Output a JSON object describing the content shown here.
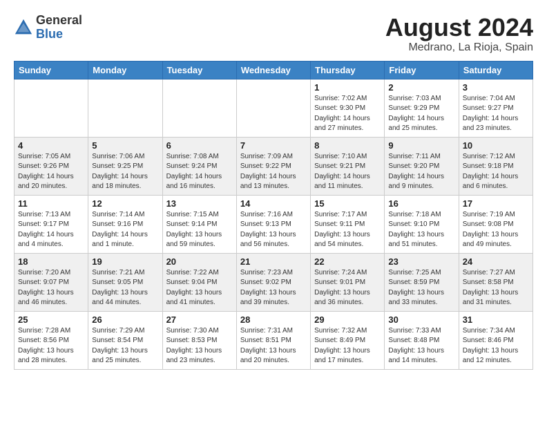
{
  "header": {
    "logo_line1": "General",
    "logo_line2": "Blue",
    "month_year": "August 2024",
    "location": "Medrano, La Rioja, Spain"
  },
  "weekdays": [
    "Sunday",
    "Monday",
    "Tuesday",
    "Wednesday",
    "Thursday",
    "Friday",
    "Saturday"
  ],
  "weeks": [
    [
      {
        "day": "",
        "info": ""
      },
      {
        "day": "",
        "info": ""
      },
      {
        "day": "",
        "info": ""
      },
      {
        "day": "",
        "info": ""
      },
      {
        "day": "1",
        "info": "Sunrise: 7:02 AM\nSunset: 9:30 PM\nDaylight: 14 hours\nand 27 minutes."
      },
      {
        "day": "2",
        "info": "Sunrise: 7:03 AM\nSunset: 9:29 PM\nDaylight: 14 hours\nand 25 minutes."
      },
      {
        "day": "3",
        "info": "Sunrise: 7:04 AM\nSunset: 9:27 PM\nDaylight: 14 hours\nand 23 minutes."
      }
    ],
    [
      {
        "day": "4",
        "info": "Sunrise: 7:05 AM\nSunset: 9:26 PM\nDaylight: 14 hours\nand 20 minutes."
      },
      {
        "day": "5",
        "info": "Sunrise: 7:06 AM\nSunset: 9:25 PM\nDaylight: 14 hours\nand 18 minutes."
      },
      {
        "day": "6",
        "info": "Sunrise: 7:08 AM\nSunset: 9:24 PM\nDaylight: 14 hours\nand 16 minutes."
      },
      {
        "day": "7",
        "info": "Sunrise: 7:09 AM\nSunset: 9:22 PM\nDaylight: 14 hours\nand 13 minutes."
      },
      {
        "day": "8",
        "info": "Sunrise: 7:10 AM\nSunset: 9:21 PM\nDaylight: 14 hours\nand 11 minutes."
      },
      {
        "day": "9",
        "info": "Sunrise: 7:11 AM\nSunset: 9:20 PM\nDaylight: 14 hours\nand 9 minutes."
      },
      {
        "day": "10",
        "info": "Sunrise: 7:12 AM\nSunset: 9:18 PM\nDaylight: 14 hours\nand 6 minutes."
      }
    ],
    [
      {
        "day": "11",
        "info": "Sunrise: 7:13 AM\nSunset: 9:17 PM\nDaylight: 14 hours\nand 4 minutes."
      },
      {
        "day": "12",
        "info": "Sunrise: 7:14 AM\nSunset: 9:16 PM\nDaylight: 14 hours\nand 1 minute."
      },
      {
        "day": "13",
        "info": "Sunrise: 7:15 AM\nSunset: 9:14 PM\nDaylight: 13 hours\nand 59 minutes."
      },
      {
        "day": "14",
        "info": "Sunrise: 7:16 AM\nSunset: 9:13 PM\nDaylight: 13 hours\nand 56 minutes."
      },
      {
        "day": "15",
        "info": "Sunrise: 7:17 AM\nSunset: 9:11 PM\nDaylight: 13 hours\nand 54 minutes."
      },
      {
        "day": "16",
        "info": "Sunrise: 7:18 AM\nSunset: 9:10 PM\nDaylight: 13 hours\nand 51 minutes."
      },
      {
        "day": "17",
        "info": "Sunrise: 7:19 AM\nSunset: 9:08 PM\nDaylight: 13 hours\nand 49 minutes."
      }
    ],
    [
      {
        "day": "18",
        "info": "Sunrise: 7:20 AM\nSunset: 9:07 PM\nDaylight: 13 hours\nand 46 minutes."
      },
      {
        "day": "19",
        "info": "Sunrise: 7:21 AM\nSunset: 9:05 PM\nDaylight: 13 hours\nand 44 minutes."
      },
      {
        "day": "20",
        "info": "Sunrise: 7:22 AM\nSunset: 9:04 PM\nDaylight: 13 hours\nand 41 minutes."
      },
      {
        "day": "21",
        "info": "Sunrise: 7:23 AM\nSunset: 9:02 PM\nDaylight: 13 hours\nand 39 minutes."
      },
      {
        "day": "22",
        "info": "Sunrise: 7:24 AM\nSunset: 9:01 PM\nDaylight: 13 hours\nand 36 minutes."
      },
      {
        "day": "23",
        "info": "Sunrise: 7:25 AM\nSunset: 8:59 PM\nDaylight: 13 hours\nand 33 minutes."
      },
      {
        "day": "24",
        "info": "Sunrise: 7:27 AM\nSunset: 8:58 PM\nDaylight: 13 hours\nand 31 minutes."
      }
    ],
    [
      {
        "day": "25",
        "info": "Sunrise: 7:28 AM\nSunset: 8:56 PM\nDaylight: 13 hours\nand 28 minutes."
      },
      {
        "day": "26",
        "info": "Sunrise: 7:29 AM\nSunset: 8:54 PM\nDaylight: 13 hours\nand 25 minutes."
      },
      {
        "day": "27",
        "info": "Sunrise: 7:30 AM\nSunset: 8:53 PM\nDaylight: 13 hours\nand 23 minutes."
      },
      {
        "day": "28",
        "info": "Sunrise: 7:31 AM\nSunset: 8:51 PM\nDaylight: 13 hours\nand 20 minutes."
      },
      {
        "day": "29",
        "info": "Sunrise: 7:32 AM\nSunset: 8:49 PM\nDaylight: 13 hours\nand 17 minutes."
      },
      {
        "day": "30",
        "info": "Sunrise: 7:33 AM\nSunset: 8:48 PM\nDaylight: 13 hours\nand 14 minutes."
      },
      {
        "day": "31",
        "info": "Sunrise: 7:34 AM\nSunset: 8:46 PM\nDaylight: 13 hours\nand 12 minutes."
      }
    ]
  ]
}
